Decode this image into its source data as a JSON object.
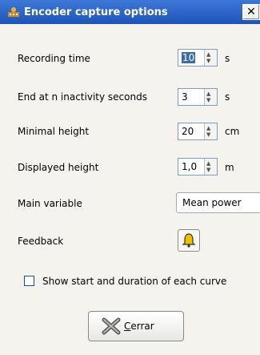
{
  "window": {
    "title": "Encoder capture options",
    "close_label": "✕"
  },
  "fields": {
    "recording_time": {
      "label": "Recording time",
      "value": "10",
      "unit": "s"
    },
    "end_inactivity": {
      "label": "End at n inactivity seconds",
      "value": "3",
      "unit": "s"
    },
    "minimal_height": {
      "label": "Minimal height",
      "value": "20",
      "unit": "cm"
    },
    "displayed_height": {
      "label": "Displayed height",
      "value": "1,0",
      "unit": "m"
    },
    "main_variable": {
      "label": "Main variable",
      "value": "Mean power"
    },
    "feedback": {
      "label": "Feedback",
      "icon": "bell-icon"
    }
  },
  "checkbox": {
    "label": "Show start and duration of each curve",
    "checked": false
  },
  "close_button": {
    "label_mnemonic": "C",
    "label_rest": "errar"
  },
  "colors": {
    "titlebar": "#1e54b8",
    "field_border": "#7f9db9",
    "background": "#f4f3ee"
  }
}
